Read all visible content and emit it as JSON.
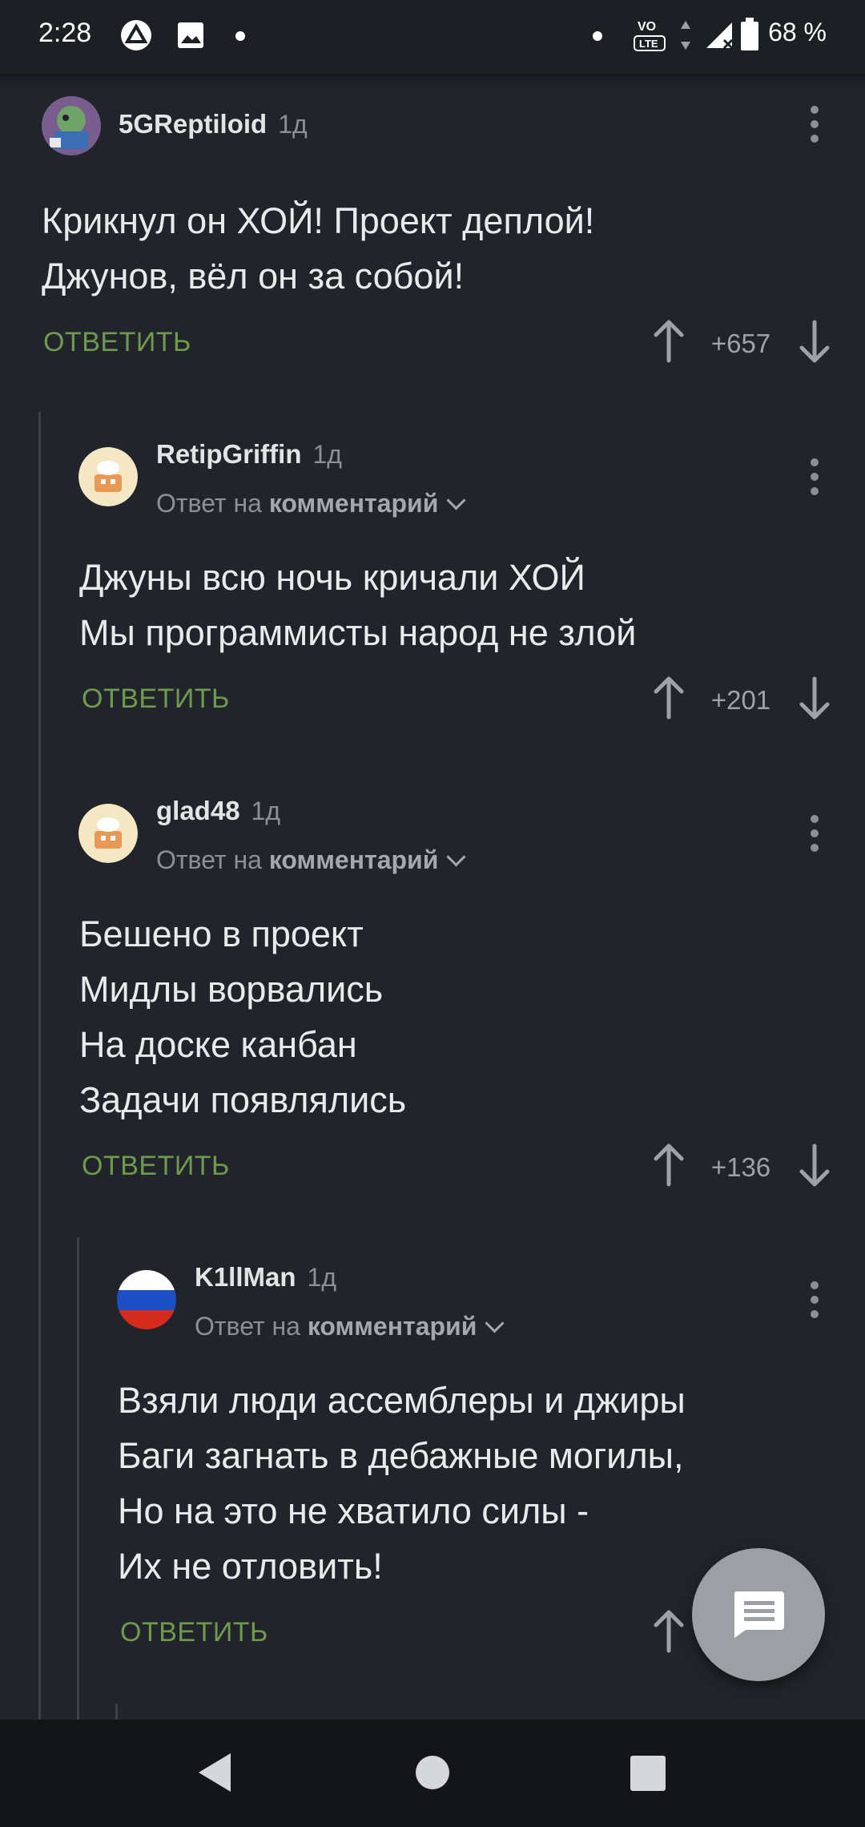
{
  "status_bar": {
    "time": "2:28",
    "battery": "68 %",
    "icons": [
      "app-icon",
      "image-icon",
      "notification-dot-icon",
      "dot-icon",
      "volte-icon",
      "data-arrows-icon",
      "signal-icon",
      "battery-icon"
    ]
  },
  "comments": [
    {
      "username": "5GReptiloid",
      "age": "1д",
      "lines": [
        "Крикнул он ХОЙ! Проект деплой!",
        "Джунов, вёл он за собой!"
      ],
      "reply_label": "ОТВЕТИТЬ",
      "score": "+657"
    },
    {
      "username": "RetipGriffin",
      "age": "1д",
      "reply_prefix": "Ответ на",
      "reply_target": "комментарий",
      "lines": [
        "Джуны всю ночь кричали ХОЙ",
        "Мы программисты народ не злой"
      ],
      "reply_label": "ОТВЕТИТЬ",
      "score": "+201"
    },
    {
      "username": "glad48",
      "age": "1д",
      "reply_prefix": "Ответ на",
      "reply_target": "комментарий",
      "lines": [
        "Бешено в проект",
        "Мидлы ворвались",
        "На доске канбан",
        "Задачи появлялись"
      ],
      "reply_label": "ОТВЕТИТЬ",
      "score": "+136"
    },
    {
      "username": "K1llMan",
      "age": "1д",
      "reply_prefix": "Ответ на",
      "reply_target": "комментарий",
      "lines": [
        "Взяли люди ассемблеры и джиры",
        "Баги загнать в дебажные могилы,",
        "Но на это не хватило силы -",
        "Их не отловить!"
      ],
      "reply_label": "ОТВЕТИТЬ"
    }
  ],
  "colors": {
    "background": "#21252b",
    "reply_green": "#6f9a4e",
    "fab": "#9c9fa4"
  },
  "fab_icon": "comment-icon"
}
